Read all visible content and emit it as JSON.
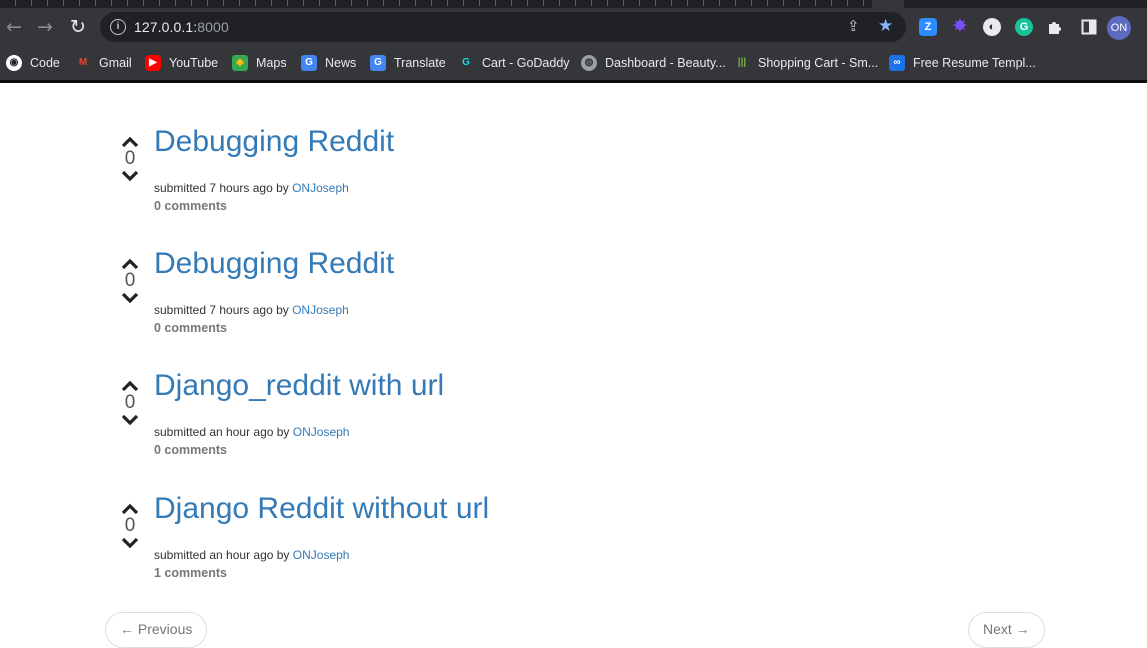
{
  "browser": {
    "url_host": "127.0.0.1:",
    "url_port": "8000",
    "profile_initials": "ON",
    "bookmarks": [
      {
        "label": "Code",
        "icon": "github-icon"
      },
      {
        "label": "Gmail",
        "icon": "gmail-icon"
      },
      {
        "label": "YouTube",
        "icon": "youtube-icon"
      },
      {
        "label": "Maps",
        "icon": "maps-icon"
      },
      {
        "label": "News",
        "icon": "news-icon"
      },
      {
        "label": "Translate",
        "icon": "translate-icon"
      },
      {
        "label": "Cart - GoDaddy",
        "icon": "godaddy-icon"
      },
      {
        "label": "Dashboard - Beauty...",
        "icon": "globe-icon"
      },
      {
        "label": "Shopping Cart - Sm...",
        "icon": "shopping-icon"
      },
      {
        "label": "Free Resume Templ...",
        "icon": "link-icon"
      }
    ],
    "extensions": [
      {
        "name": "zoom-extension-icon",
        "glyph": "Z",
        "color": "#2d8cff"
      },
      {
        "name": "gear-extension-icon",
        "glyph": "✸",
        "color": "#7c4dff"
      },
      {
        "name": "dark-reader-icon",
        "glyph": "◐",
        "color": "#5f6368"
      },
      {
        "name": "grammarly-icon",
        "glyph": "G",
        "color": "#15c39a"
      }
    ]
  },
  "posts": [
    {
      "title": "Debugging Reddit",
      "submitted": "submitted 7 hours ago by",
      "author": "ONJoseph",
      "score": "0",
      "comments": "0 comments"
    },
    {
      "title": "Debugging Reddit",
      "submitted": "submitted 7 hours ago by",
      "author": "ONJoseph",
      "score": "0",
      "comments": "0 comments"
    },
    {
      "title": "Django_reddit with url",
      "submitted": "submitted an hour ago by",
      "author": "ONJoseph",
      "score": "0",
      "comments": "0 comments"
    },
    {
      "title": "Django Reddit without url",
      "submitted": "submitted an hour ago by",
      "author": "ONJoseph",
      "score": "0",
      "comments": "1 comments"
    }
  ],
  "pager": {
    "previous": "← Previous",
    "next": "Next →"
  },
  "colors": {
    "link": "#337ab7",
    "chrome_dark": "#35363a"
  }
}
